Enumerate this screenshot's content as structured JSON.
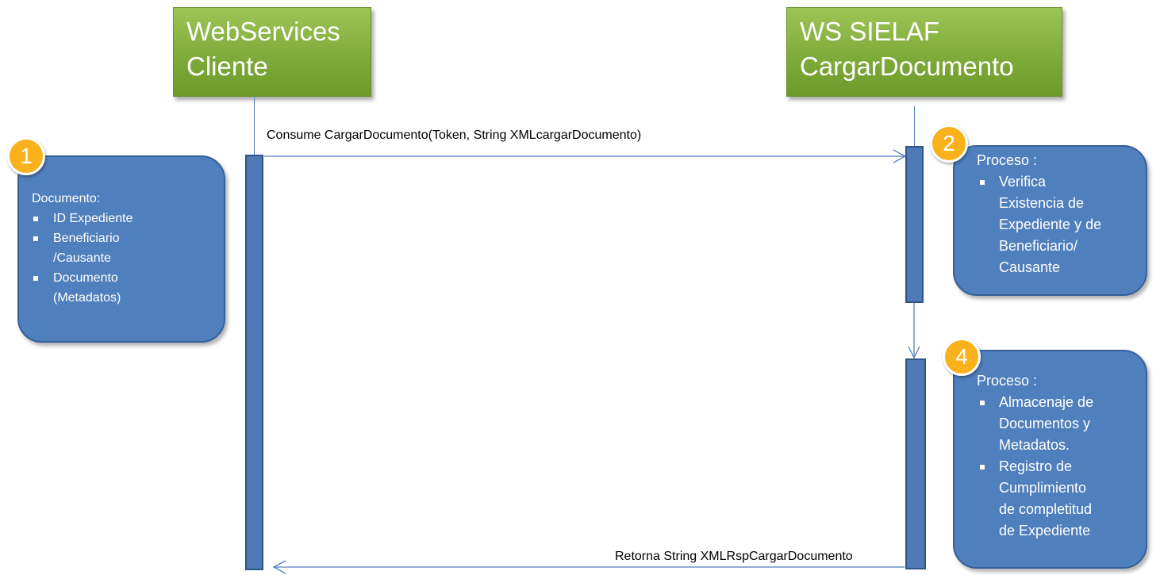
{
  "actors": {
    "client": {
      "line1": "WebServices",
      "line2": "Cliente"
    },
    "server": {
      "line1": "WS SIELAF",
      "line2": "CargarDocumento"
    }
  },
  "messages": {
    "request": "Consume CargarDocumento(Token, String XMLcargarDocumento)",
    "response": "Retorna String XMLRspCargarDocumento"
  },
  "notes": {
    "step1": {
      "number": "1",
      "title": "Documento:",
      "items": [
        "ID Expediente",
        "Beneficiario",
        "/Causante",
        "Documento",
        "(Metadatos)"
      ]
    },
    "step2": {
      "number": "2",
      "title": "Proceso :",
      "item1_lines": [
        "Verifica",
        "Existencia de",
        "Expediente y de",
        "Beneficiario/",
        "Causante"
      ]
    },
    "step4": {
      "number": "4",
      "title": "Proceso :",
      "item1_lines": [
        "Almacenaje de",
        "Documentos y",
        "Metadatos."
      ],
      "item2_lines": [
        "Registro de",
        "Cumplimiento",
        "de completitud",
        "de  Expediente"
      ]
    }
  },
  "colors": {
    "actor_green": "#7fab3a",
    "note_blue": "#4f7fbc",
    "badge_orange": "#f9b11c",
    "line_blue": "#4f81bd"
  }
}
